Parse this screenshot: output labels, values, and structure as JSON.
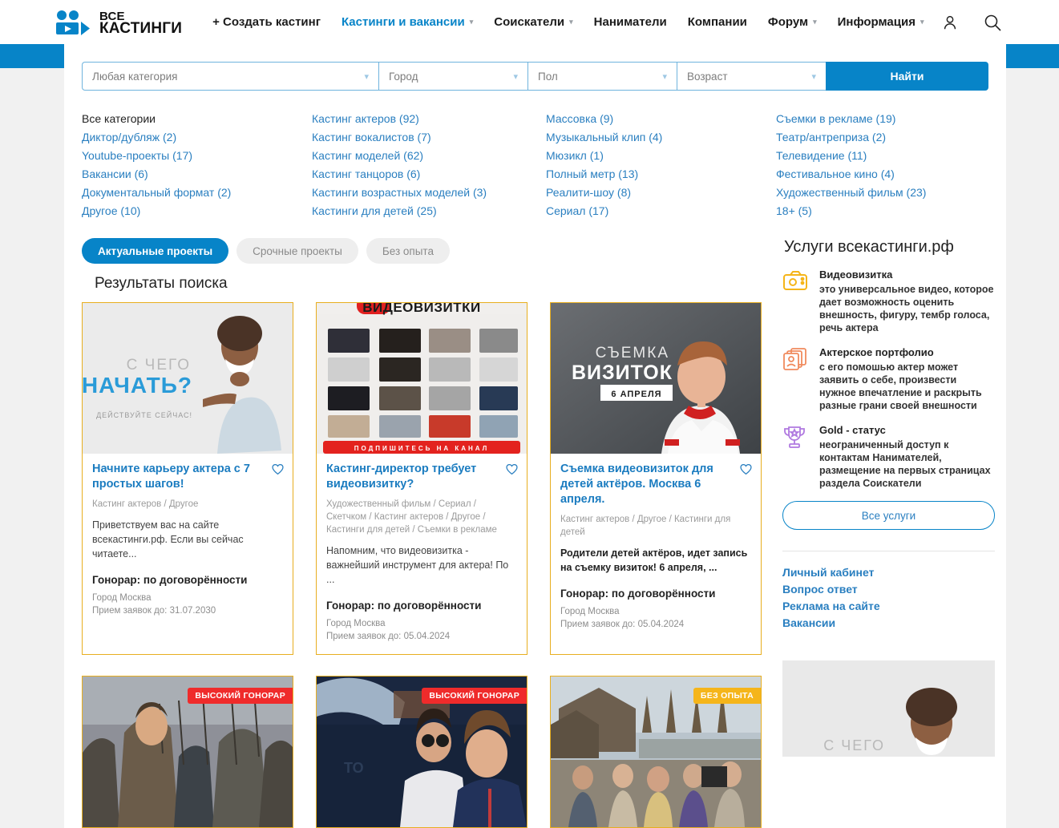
{
  "header": {
    "logo": {
      "line1": "ВСЕ",
      "line2": "КАСТИНГИ",
      "icon": "video-camera-logo-icon"
    },
    "nav": [
      {
        "label": "+ Создать кастинг",
        "accent": false,
        "caret": false
      },
      {
        "label": "Кастинги и вакансии",
        "accent": true,
        "caret": true
      },
      {
        "label": "Соискатели",
        "accent": false,
        "caret": true
      },
      {
        "label": "Наниматели",
        "accent": false,
        "caret": false
      },
      {
        "label": "Компании",
        "accent": false,
        "caret": false
      },
      {
        "label": "Форум",
        "accent": false,
        "caret": true
      },
      {
        "label": "Информация",
        "accent": false,
        "caret": true
      }
    ],
    "icons": {
      "account": "user-icon",
      "search": "search-icon"
    }
  },
  "filters": {
    "category": "Любая категория",
    "city": "Город",
    "gender": "Пол",
    "age": "Возраст",
    "search_label": "Найти"
  },
  "categories": {
    "col1": [
      {
        "label": "Все категории",
        "link": false
      },
      {
        "label": "Диктор/дубляж (2)",
        "link": true
      },
      {
        "label": "Youtube-проекты (17)",
        "link": true
      },
      {
        "label": "Вакансии (6)",
        "link": true
      },
      {
        "label": "Документальный формат (2)",
        "link": true
      },
      {
        "label": "Другое (10)",
        "link": true
      }
    ],
    "col2": [
      {
        "label": "Кастинг актеров (92)",
        "link": true
      },
      {
        "label": "Кастинг вокалистов (7)",
        "link": true
      },
      {
        "label": "Кастинг моделей (62)",
        "link": true
      },
      {
        "label": "Кастинг танцоров (6)",
        "link": true
      },
      {
        "label": "Кастинги возрастных моделей (3)",
        "link": true
      },
      {
        "label": "Кастинги для детей (25)",
        "link": true
      }
    ],
    "col3": [
      {
        "label": "Массовка (9)",
        "link": true
      },
      {
        "label": "Музыкальный клип (4)",
        "link": true
      },
      {
        "label": "Мюзикл (1)",
        "link": true
      },
      {
        "label": "Полный метр (13)",
        "link": true
      },
      {
        "label": "Реалити-шоу (8)",
        "link": true
      },
      {
        "label": "Сериал (17)",
        "link": true
      }
    ],
    "col4": [
      {
        "label": "Съемки в рекламе (19)",
        "link": true
      },
      {
        "label": "Театр/антреприза (2)",
        "link": true
      },
      {
        "label": "Телевидение (11)",
        "link": true
      },
      {
        "label": "Фестивальное кино (4)",
        "link": true
      },
      {
        "label": "Художественный фильм (23)",
        "link": true
      },
      {
        "label": "18+ (5)",
        "link": true
      }
    ]
  },
  "tabs": [
    {
      "label": "Актуальные проекты",
      "active": true
    },
    {
      "label": "Срочные проекты",
      "active": false
    },
    {
      "label": "Без опыта",
      "active": false
    }
  ],
  "results": {
    "heading": "Результаты поиска"
  },
  "cards": [
    {
      "title": "Начните карьеру актера с 7 простых шагов!",
      "cats": "Кастинг актеров / Другое",
      "desc": "Приветствуем вас на сайте всекастинги.рф. Если вы сейчас читаете...",
      "desc_bold": false,
      "fee": "Гонорар: по договорённости",
      "city": "Город Москва",
      "deadline": "Прием заявок до: 31.07.2030",
      "image": {
        "kind": "poster-start-career",
        "line1": "С ЧЕГО",
        "line2": "НАЧАТЬ?",
        "line3": "ДЕЙСТВУЙТЕ СЕЙЧАС!"
      }
    },
    {
      "title": "Кастинг-директор требует видеовизитку?",
      "cats": "Художественный фильм / Сериал / Скетчком / Кастинг актеров / Другое / Кастинги для детей / Съемки в рекламе",
      "desc": "Напомним, что видеовизитка - важнейший инструмент для актера! По ...",
      "desc_bold": false,
      "fee": "Гонорар: по договорённости",
      "city": "Город Москва",
      "deadline": "Прием заявок до: 05.04.2024",
      "image": {
        "kind": "poster-video-cards-grid",
        "line1": "ВИДЕОВИЗИТКИ",
        "line3": "ПОДПИШИТЕСЬ НА КАНАЛ"
      }
    },
    {
      "title": "Съемка видеовизиток для детей актёров. Москва 6 апреля.",
      "cats": "Кастинг актеров / Другое / Кастинги для детей",
      "desc": "Родители детей актёров, идет запись на съемку визиток! 6 апреля, ...",
      "desc_bold": true,
      "fee": "Гонорар: по договорённости",
      "city": "Город Москва",
      "deadline": "Прием заявок до: 05.04.2024",
      "image": {
        "kind": "poster-child-shooting",
        "line1": "СЪЕМКА",
        "line2": "ВИЗИТОК",
        "line3": "6 АПРЕЛЯ"
      }
    }
  ],
  "cards_row2": [
    {
      "badge": "ВЫСОКИЙ ГОНОРАР",
      "badge_color": "red",
      "image": {
        "kind": "photo-vikings-battle"
      }
    },
    {
      "badge": "ВЫСОКИЙ ГОНОРАР",
      "badge_color": "red",
      "image": {
        "kind": "photo-couple-car"
      }
    },
    {
      "badge": "БЕЗ ОПЫТА",
      "badge_color": "yellow",
      "image": {
        "kind": "photo-war-village-crowd"
      }
    }
  ],
  "sidebar": {
    "title": "Услуги всекастинги.рф",
    "services": [
      {
        "icon": "camera-icon",
        "name": "Видеовизитка",
        "desc": "это универсальное видео, которое дает возможность оценить внешность, фигуру, тембр голоса, речь актера"
      },
      {
        "icon": "photos-stack-icon",
        "name": "Актерское портфолио",
        "desc": "с его помошью актер может заявить о себе, произвести нужное впечатление и раскрыть разные грани своей внешности"
      },
      {
        "icon": "trophy-icon",
        "name": "Gold - статус",
        "desc": "неограниченный доступ к контактам Нанимателей, размещение на первых страницах раздела Соискатели"
      }
    ],
    "all_services_label": "Все услуги",
    "links": [
      {
        "label": "Личный кабинет"
      },
      {
        "label": "Вопрос ответ"
      },
      {
        "label": "Реклама на сайте"
      },
      {
        "label": "Вакансии"
      }
    ],
    "promo": {
      "line1": "С ЧЕГО"
    }
  },
  "colors": {
    "accent_blue": "#0784c8",
    "link_blue": "#2a7fc0",
    "card_border": "#e8ae1f",
    "badge_red": "#ef2b2b",
    "badge_yellow": "#f5b51a"
  }
}
